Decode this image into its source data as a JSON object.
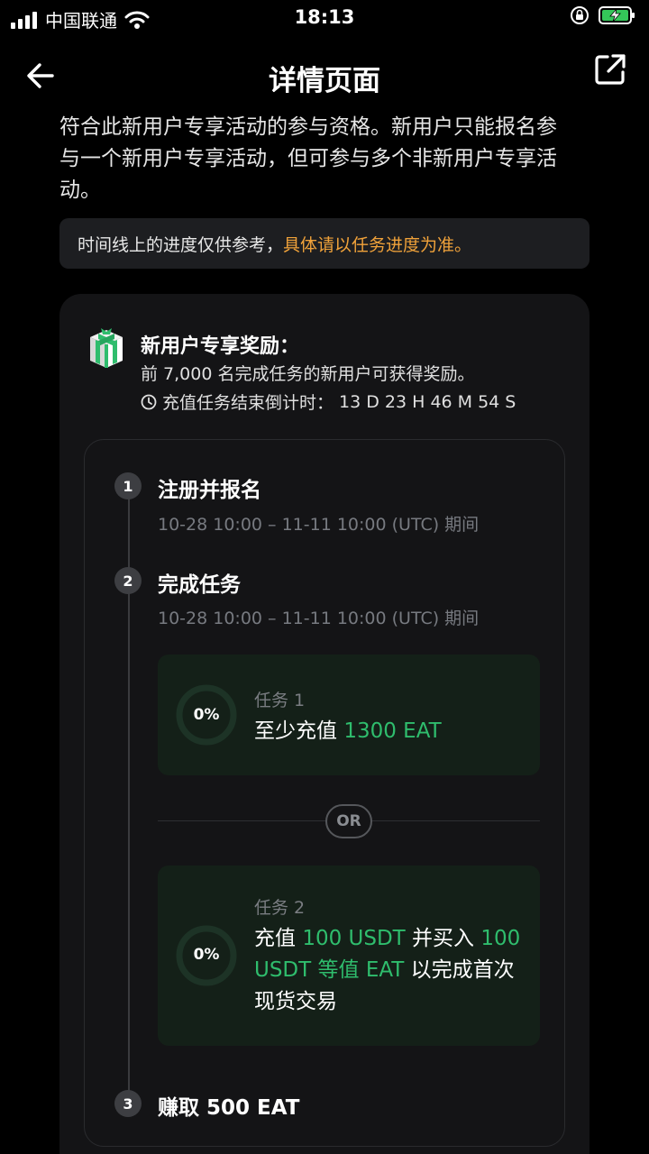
{
  "status_bar": {
    "carrier": "中国联通",
    "time": "18:13"
  },
  "nav": {
    "title": "详情页面",
    "back_icon": "arrow-left-icon",
    "share_icon": "external-link-icon"
  },
  "intro": {
    "line1": "符合此新用户专享活动的参与资格。新用户只能报名参",
    "line2": "与一个新用户专享活动，但可参与多个非新用户专享活",
    "line3": "动。"
  },
  "notice": {
    "prefix": "时间线上的进度仅供参考，",
    "highlight": "具体请以任务进度为准。"
  },
  "reward": {
    "title": "新用户专享奖励：",
    "desc": "前 7,000 名完成任务的新用户可获得奖励。",
    "countdown_label": "充值任务结束倒计时：",
    "countdown_value": "13 D  23 H  46 M  54 S"
  },
  "steps": [
    {
      "num": "1",
      "title": "注册并报名",
      "time": "10-28 10:00 – 11-11 10:00 (UTC) 期间"
    },
    {
      "num": "2",
      "title": "完成任务",
      "time": "10-28 10:00 – 11-11 10:00 (UTC) 期间"
    },
    {
      "num": "3",
      "title": "赚取 500 EAT"
    }
  ],
  "tasks": [
    {
      "progress_text": "0%",
      "progress": 0,
      "label": "任务 1",
      "body_prefix": "至少充值 ",
      "body_green": "1300 EAT"
    },
    {
      "progress_text": "0%",
      "progress": 0,
      "label": "任务 2",
      "part1": "充值 ",
      "green1": "100 USDT",
      "part2": " 并买入 ",
      "green2": "100 USDT 等值 EAT",
      "part3": " 以完成首次现货交易"
    }
  ],
  "or_label": "OR",
  "colors": {
    "accent_green": "#2fbd6d",
    "accent_orange": "#f0a23a",
    "background": "#000000"
  }
}
